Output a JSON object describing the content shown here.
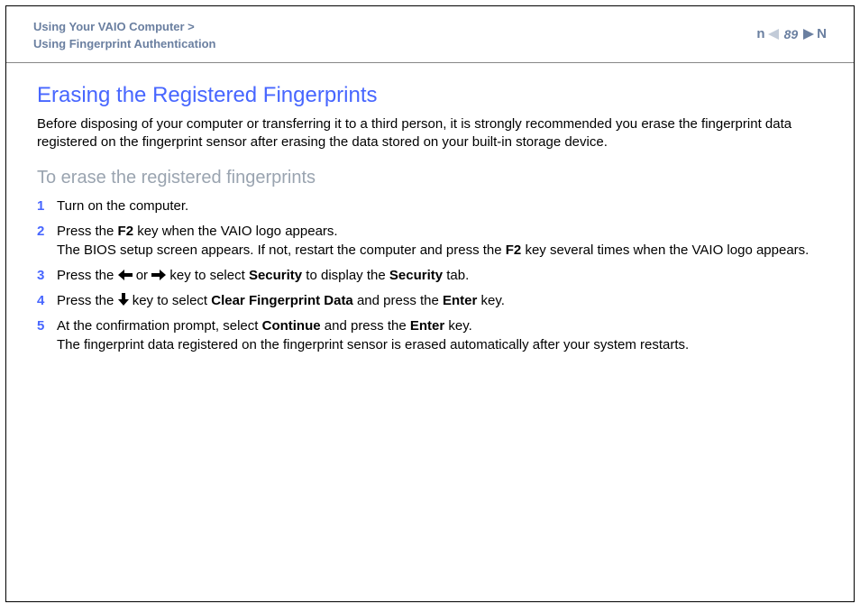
{
  "breadcrumb": {
    "line1": "Using Your VAIO Computer >",
    "line2": "Using Fingerprint Authentication"
  },
  "page_nav": {
    "n_label": "n",
    "page_number": "89",
    "N_label": "N"
  },
  "title": "Erasing the Registered Fingerprints",
  "intro": "Before disposing of your computer or transferring it to a third person, it is strongly recommended you erase the fingerprint data registered on the fingerprint sensor after erasing the data stored on your built-in storage device.",
  "subheading": "To erase the registered fingerprints",
  "steps": {
    "s1": {
      "num": "1",
      "text": "Turn on the computer."
    },
    "s2": {
      "num": "2",
      "t1": "Press the ",
      "b1": "F2",
      "t2": " key when the VAIO logo appears.",
      "t3": "The BIOS setup screen appears. If not, restart the computer and press the ",
      "b2": "F2",
      "t4": " key several times when the VAIO logo appears."
    },
    "s3": {
      "num": "3",
      "t1": "Press the ",
      "t2": " or ",
      "t3": " key to select ",
      "b1": "Security",
      "t4": " to display the ",
      "b2": "Security",
      "t5": " tab."
    },
    "s4": {
      "num": "4",
      "t1": "Press the ",
      "t2": " key to select ",
      "b1": "Clear Fingerprint Data",
      "t3": " and press the ",
      "b2": "Enter",
      "t4": " key."
    },
    "s5": {
      "num": "5",
      "t1": "At the confirmation prompt, select ",
      "b1": "Continue",
      "t2": " and press the ",
      "b2": "Enter",
      "t3": " key.",
      "t4": "The fingerprint data registered on the fingerprint sensor is erased automatically after your system restarts."
    }
  }
}
